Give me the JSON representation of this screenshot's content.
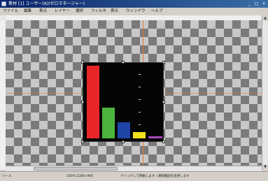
{
  "window": {
    "title": "素材 [1] ユーザー(A)(ゼロマネージャー)",
    "minimize": "_",
    "maximize": "□",
    "close": "×"
  },
  "menu": {
    "items": [
      "ファイル",
      "編集",
      "表示",
      "レイヤー",
      "選択",
      "フィルタ",
      "表示",
      "ウィンドウ",
      "ヘルプ"
    ]
  },
  "image": {
    "bars": [
      {
        "value": 1.0,
        "color": "#e8262a"
      },
      {
        "value": 0.42,
        "color": "#4db53e"
      },
      {
        "value": 0.22,
        "color": "#1f45a8"
      },
      {
        "value": 0.09,
        "color": "#f2e31f"
      },
      {
        "value": 0.03,
        "color": "#a44ab6"
      }
    ]
  },
  "status": {
    "left": "ツール",
    "middle": "100%  1280×960",
    "right": "クリックして移動します / 選択範囲を変更します"
  },
  "colors": {
    "title_bg": "#0a246a",
    "guide": "#e07a3a",
    "chart_bg": "#050505"
  },
  "icons": [
    "app-icon",
    "scroll-up-icon",
    "scroll-down-icon"
  ]
}
